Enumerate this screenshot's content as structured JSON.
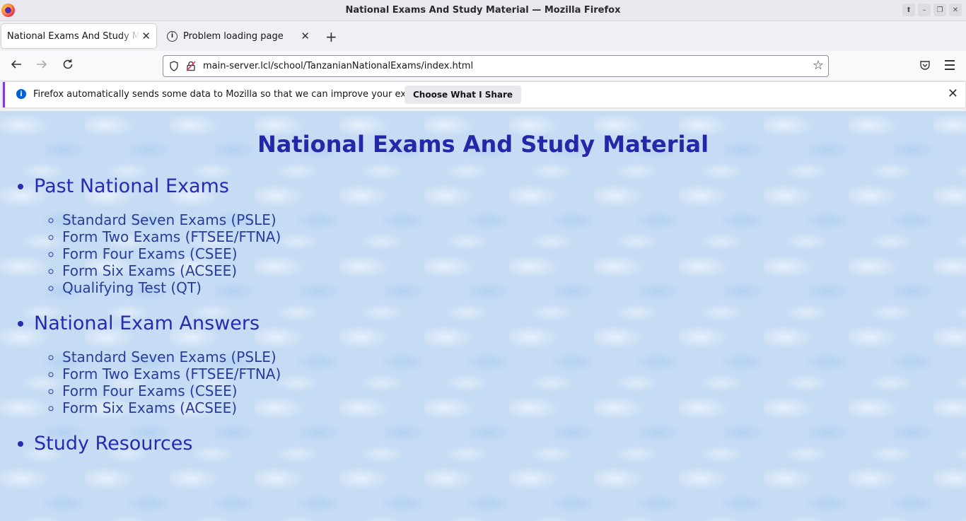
{
  "window": {
    "title": "National Exams And Study Material — Mozilla Firefox"
  },
  "tabs": [
    {
      "label": "National Exams And Study Material",
      "active": true
    },
    {
      "label": "Problem loading page",
      "active": false
    }
  ],
  "navbar": {
    "url": "main-server.lcl/school/TanzanianNationalExams/index.html"
  },
  "notification": {
    "message": "Firefox automatically sends some data to Mozilla so that we can improve your experience.",
    "button_label": "Choose What I Share"
  },
  "page": {
    "heading": "National Exams And Study Material",
    "sections": [
      {
        "title": "Past National Exams",
        "items": [
          "Standard Seven Exams (PSLE)",
          "Form Two Exams (FTSEE/FTNA)",
          "Form Four Exams (CSEE)",
          "Form Six Exams (ACSEE)",
          "Qualifying Test (QT)"
        ]
      },
      {
        "title": "National Exam Answers",
        "items": [
          "Standard Seven Exams (PSLE)",
          "Form Two Exams (FTSEE/FTNA)",
          "Form Four Exams (CSEE)",
          "Form Six Exams (ACSEE)"
        ]
      },
      {
        "title": "Study Resources",
        "items": []
      }
    ]
  },
  "icons": {
    "back": "arrow-left-icon",
    "forward": "arrow-right-icon",
    "reload": "reload-icon",
    "bookmark": "star-icon",
    "pocket": "pocket-icon",
    "menu": "hamburger-menu-icon"
  }
}
